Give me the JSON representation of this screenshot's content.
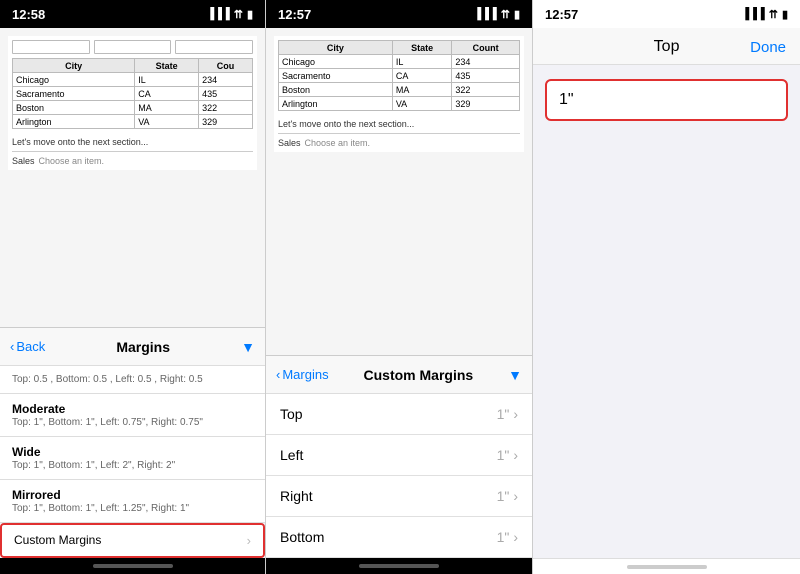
{
  "panel1": {
    "statusBar": {
      "time": "12:58"
    },
    "table": {
      "headers": [
        "City",
        "State",
        "Cou"
      ],
      "rows": [
        [
          "Chicago",
          "IL",
          "234"
        ],
        [
          "Sacramento",
          "CA",
          "435"
        ],
        [
          "Boston",
          "MA",
          "322"
        ],
        [
          "Arlington",
          "VA",
          "329"
        ]
      ]
    },
    "docText": "Let's move onto the next section...",
    "dropdown": {
      "label": "Sales",
      "placeholder": "Choose an item."
    },
    "navTitle": "Margins",
    "backLabel": "Back",
    "marginItems": [
      {
        "title": "",
        "desc": "Top: 0.5 , Bottom: 0.5 , Left: 0.5 , Right: 0.5"
      },
      {
        "title": "Moderate",
        "desc": "Top: 1\", Bottom: 1\", Left: 0.75\", Right: 0.75\""
      },
      {
        "title": "Wide",
        "desc": "Top: 1\", Bottom: 1\", Left: 2\", Right: 2\""
      },
      {
        "title": "Mirrored",
        "desc": "Top: 1\", Bottom: 1\", Left: 1.25\", Right: 1\""
      }
    ],
    "customLabel": "Custom Margins",
    "chevron": "›"
  },
  "panel2": {
    "statusBar": {
      "time": "12:57"
    },
    "table": {
      "headers": [
        "City",
        "State",
        "Count"
      ],
      "rows": [
        [
          "Chicago",
          "IL",
          "234"
        ],
        [
          "Sacramento",
          "CA",
          "435"
        ],
        [
          "Boston",
          "MA",
          "322"
        ],
        [
          "Arlington",
          "VA",
          "329"
        ]
      ]
    },
    "docText": "Let's move onto the next section...",
    "dropdown": {
      "label": "Sales",
      "placeholder": "Choose an item."
    },
    "backLabel": "Margins",
    "navTitle": "Custom Margins",
    "items": [
      {
        "label": "Top",
        "value": "1\""
      },
      {
        "label": "Left",
        "value": "1\""
      },
      {
        "label": "Right",
        "value": "1\""
      },
      {
        "label": "Bottom",
        "value": "1\""
      }
    ]
  },
  "panel3": {
    "statusBar": {
      "time": "12:57"
    },
    "navTitle": "Top",
    "doneLabel": "Done",
    "inputValue": "1\""
  },
  "icons": {
    "back": "‹",
    "chevronDown": "▼",
    "chevronRight": "›",
    "signal": "▐▐▐▐",
    "wifi": "WiFi",
    "battery": "🔋"
  }
}
